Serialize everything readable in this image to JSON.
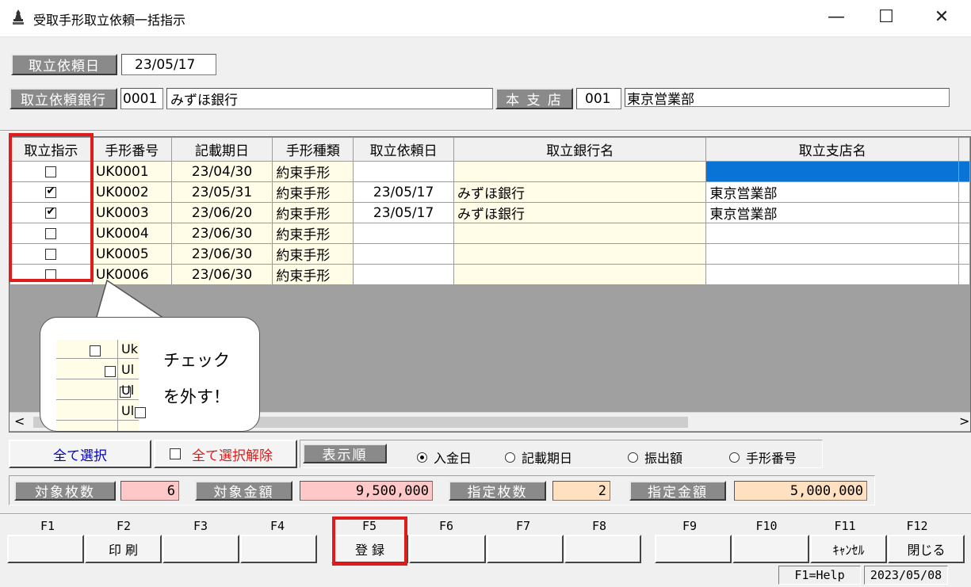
{
  "window": {
    "title": "受取手形取立依頼一括指示",
    "minimize": "—",
    "maximize": "☐",
    "close": "✕"
  },
  "header": {
    "request_date_label": "取立依頼日",
    "request_date_value": "23/05/17",
    "bank_label": "取立依頼銀行",
    "bank_code": "0001",
    "bank_name": "みずほ銀行",
    "branch_label": "本 支 店",
    "branch_code": "001",
    "branch_name": "東京営業部"
  },
  "grid": {
    "columns": [
      "取立指示",
      "手形番号",
      "記載期日",
      "手形種類",
      "取立依頼日",
      "取立銀行名",
      "取立支店名"
    ],
    "rows": [
      {
        "checked": false,
        "no": "UK0001",
        "due": "23/04/30",
        "type": "約束手形",
        "req_date": "",
        "bank": "",
        "branch": ""
      },
      {
        "checked": true,
        "no": "UK0002",
        "due": "23/05/31",
        "type": "約束手形",
        "req_date": "23/05/17",
        "bank": "みずほ銀行",
        "branch": "東京営業部"
      },
      {
        "checked": true,
        "no": "UK0003",
        "due": "23/06/20",
        "type": "約束手形",
        "req_date": "23/05/17",
        "bank": "みずほ銀行",
        "branch": "東京営業部"
      },
      {
        "checked": false,
        "no": "UK0004",
        "due": "23/06/30",
        "type": "約束手形",
        "req_date": "",
        "bank": "",
        "branch": ""
      },
      {
        "checked": false,
        "no": "UK0005",
        "due": "23/06/30",
        "type": "約束手形",
        "req_date": "",
        "bank": "",
        "branch": ""
      },
      {
        "checked": false,
        "no": "UK0006",
        "due": "23/06/30",
        "type": "約束手形",
        "req_date": "",
        "bank": "",
        "branch": ""
      }
    ]
  },
  "callout": {
    "line1": "チェック",
    "line2": "を外す！",
    "snippet_text": [
      "Uk",
      "Ul",
      "Ul",
      "Ul"
    ]
  },
  "controls": {
    "select_all": "全て選択",
    "deselect_all": "全て選択解除",
    "display_order_label": "表示順",
    "sort_options": [
      {
        "label": "入金日",
        "selected": true
      },
      {
        "label": "記載期日",
        "selected": false
      },
      {
        "label": "振出額",
        "selected": false
      },
      {
        "label": "手形番号",
        "selected": false
      }
    ]
  },
  "summary": {
    "target_count_label": "対象枚数",
    "target_count": "6",
    "target_amount_label": "対象金額",
    "target_amount": "9,500,000",
    "specified_count_label": "指定枚数",
    "specified_count": "2",
    "specified_amount_label": "指定金額",
    "specified_amount": "5,000,000"
  },
  "function_keys": [
    {
      "key": "F1",
      "label": ""
    },
    {
      "key": "F2",
      "label": "印 刷"
    },
    {
      "key": "F3",
      "label": ""
    },
    {
      "key": "F4",
      "label": ""
    },
    {
      "key": "F5",
      "label": "登 録"
    },
    {
      "key": "F6",
      "label": ""
    },
    {
      "key": "F7",
      "label": ""
    },
    {
      "key": "F8",
      "label": ""
    },
    {
      "key": "F9",
      "label": ""
    },
    {
      "key": "F10",
      "label": ""
    },
    {
      "key": "F11",
      "label": "ｷｬﾝｾﾙ"
    },
    {
      "key": "F12",
      "label": "閉じる"
    }
  ],
  "status": {
    "help": "F1=Help",
    "date": "2023/05/08"
  },
  "colors": {
    "accent_red": "#e01b1b",
    "pink_field": "#ffc8c8",
    "peach_field": "#ffe0c0",
    "cell_yellow": "#fffde8",
    "selection_blue": "#0a74d6"
  }
}
